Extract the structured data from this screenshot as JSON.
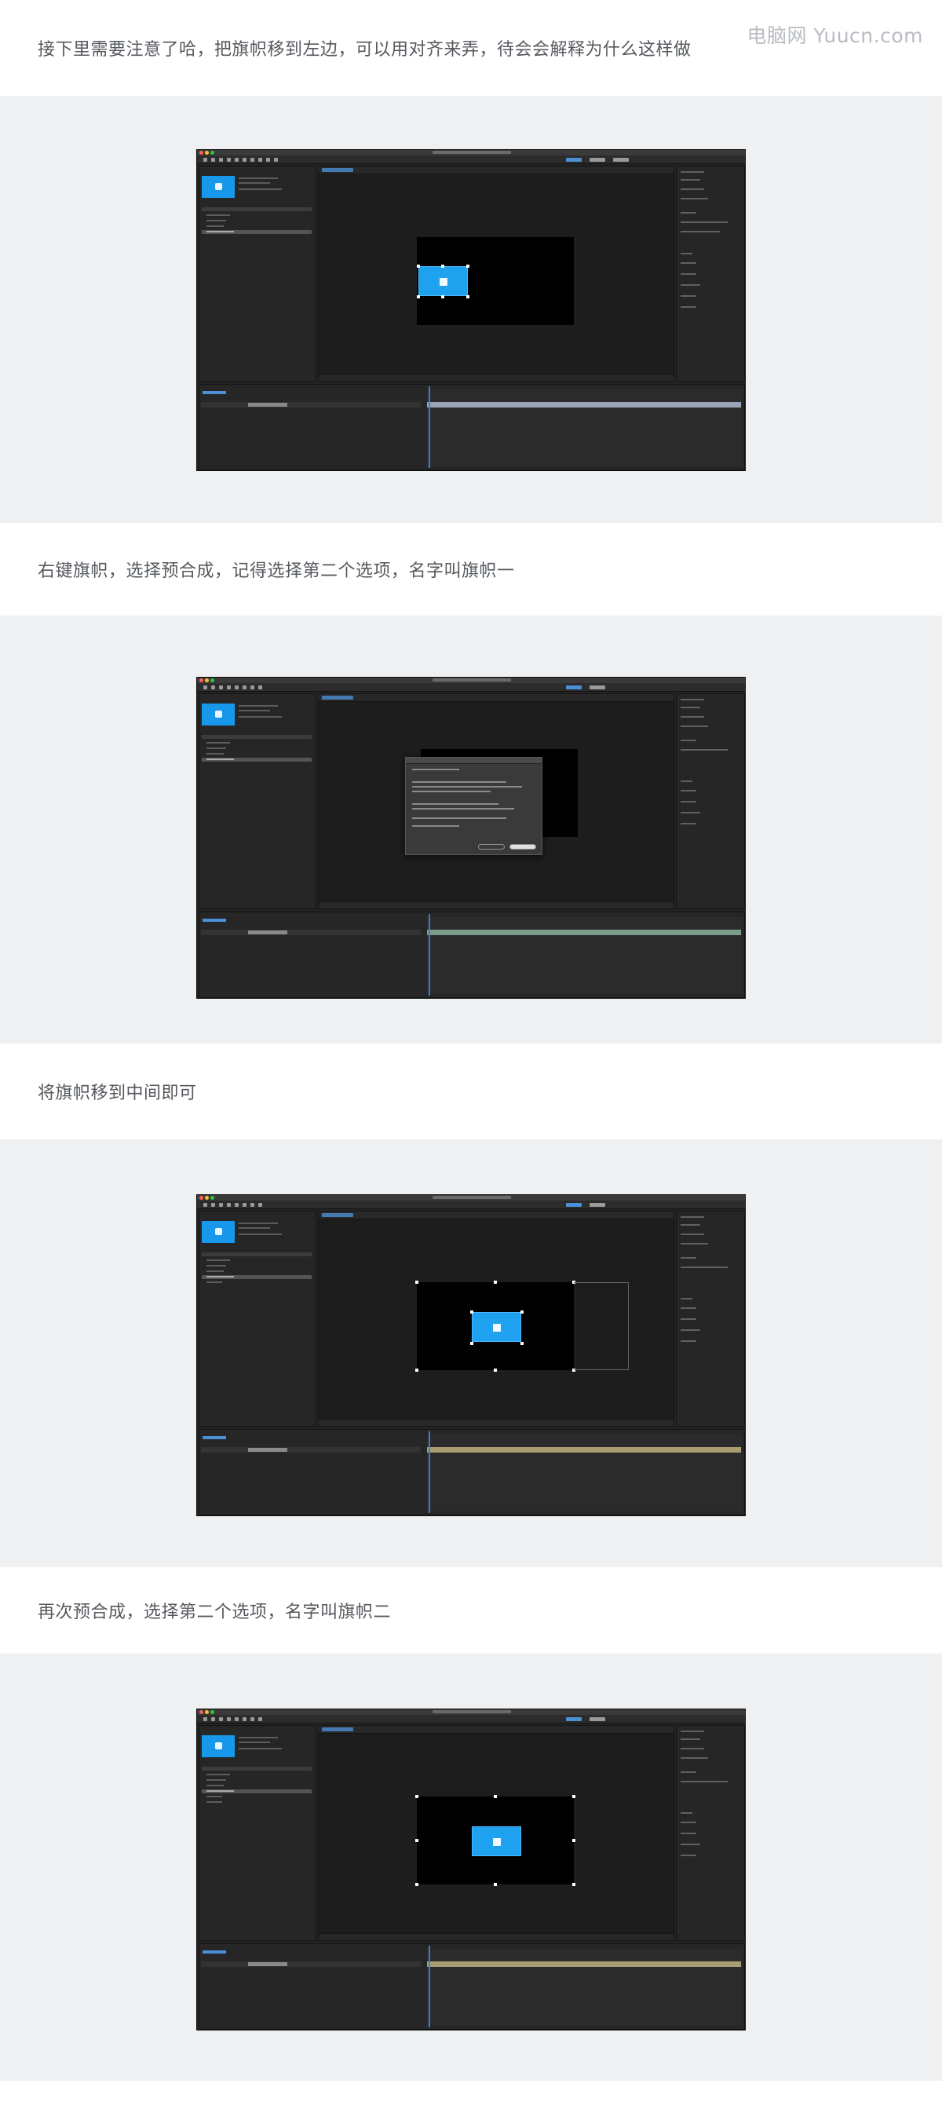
{
  "watermark": "电脑网 Yuucn.com",
  "steps": [
    {
      "caption": "接下里需要注意了哈，把旗帜移到左边，可以用对齐来弄，待会会解释为什么这样做"
    },
    {
      "caption": "右键旗帜，选择预合成，记得选择第二个选项，名字叫旗帜一"
    },
    {
      "caption": "将旗帜移到中间即可"
    },
    {
      "caption": "再次预合成，选择第二个选项，名字叫旗帜二"
    }
  ],
  "colors": {
    "flag_blue": "#1ea2f0",
    "band_gray": "#eff0f2",
    "ae_dark": "#232323",
    "timeline_bar_step1": "#9aa3b8",
    "timeline_bar_step2": "#7d9c8a",
    "timeline_bar_step3": "#a99d74"
  }
}
